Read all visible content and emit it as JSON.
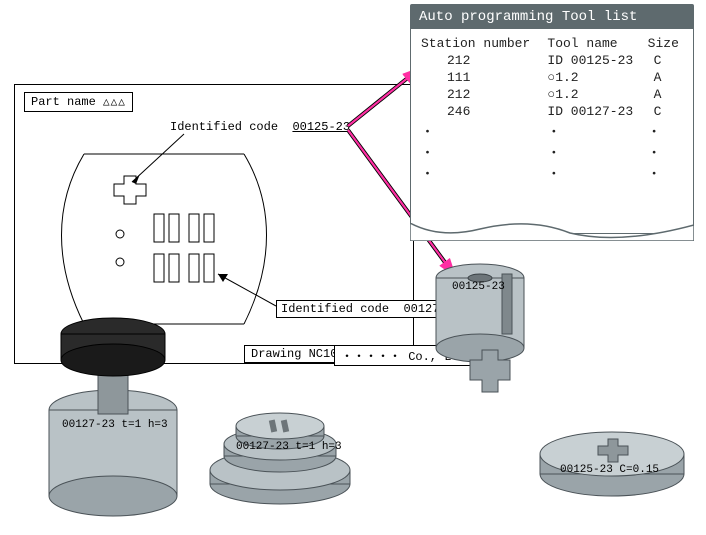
{
  "drawing": {
    "part_name_label": "Part name",
    "part_name_value": "△△△",
    "identified_code_label_top": "Identified code",
    "identified_code_value_top": "00125-23",
    "identified_code_label_bottom": "Identified code",
    "identified_code_value_bottom": "00127-23",
    "drawing_number": "Drawing NC1082",
    "company": "・・・・・ Co., LTD."
  },
  "tool_list": {
    "title": "Auto programming  Tool list",
    "headers": {
      "station": "Station number",
      "tool": "Tool name",
      "size": "Size"
    },
    "rows": [
      {
        "station": "212",
        "tool": "ID 00125-23",
        "size": "C"
      },
      {
        "station": "111",
        "tool": "○1.2",
        "size": "A"
      },
      {
        "station": "212",
        "tool": "○1.2",
        "size": "A"
      },
      {
        "station": "246",
        "tool": "ID 00127-23",
        "size": "C"
      }
    ],
    "ellipsis": "・"
  },
  "tools": {
    "punch_top_label": "00125-23",
    "die1_label": "00127-23  t=1 h=3",
    "die2_label": "00127-23  t=1 h=3",
    "die3_label": "00125-23 C=0.15"
  }
}
